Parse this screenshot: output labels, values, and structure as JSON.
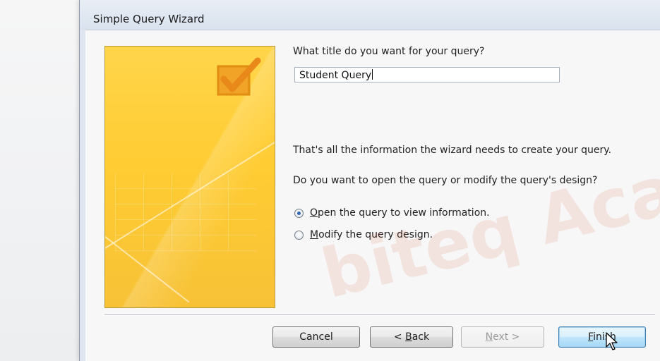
{
  "window": {
    "title": "Simple Query Wizard"
  },
  "wizard": {
    "question": "What title do you want for your query?",
    "title_value": "Student Query",
    "info": "That's all the information the wizard needs to create your query.",
    "ask": "Do you want to open the query or modify the query's design?",
    "options": [
      {
        "accel": "O",
        "rest": "pen the query to view information.",
        "checked": true
      },
      {
        "accel": "M",
        "rest": "odify the query design.",
        "checked": false
      }
    ]
  },
  "buttons": {
    "cancel": "Cancel",
    "back_prefix": "< ",
    "back_accel": "B",
    "back_rest": "ack",
    "next_accel": "N",
    "next_rest": "ext >",
    "finish_accel": "F",
    "finish_rest": "inish"
  },
  "watermark": "biteq Aca",
  "colors": {
    "banner": "#ffcc33",
    "default_button": "#bee6fd",
    "radio_selected": "#2d64b7"
  }
}
